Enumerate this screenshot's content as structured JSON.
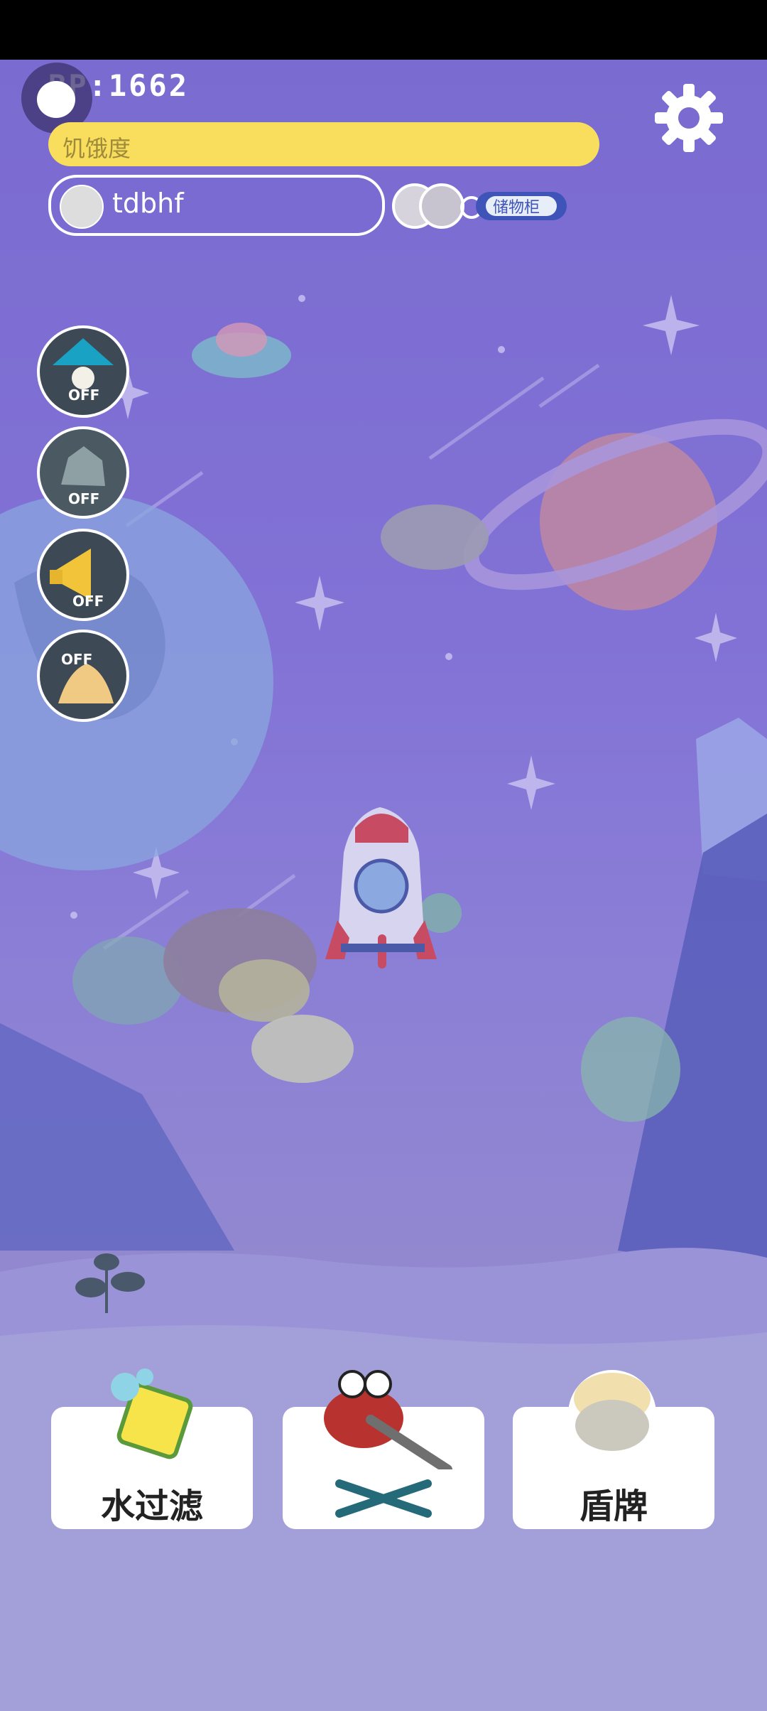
{
  "header": {
    "bp_text": "BP:1662",
    "hunger_label": "饥饿度",
    "hunger_color": "#f9dd5c"
  },
  "player": {
    "name": "tdbhf"
  },
  "locker": {
    "label": "储物柜"
  },
  "tools": [
    {
      "name": "lamp",
      "status": "OFF",
      "icon": "lamp-icon"
    },
    {
      "name": "rock",
      "status": "OFF",
      "icon": "rock-icon"
    },
    {
      "name": "megaphone",
      "status": "OFF",
      "icon": "megaphone-icon"
    },
    {
      "name": "shell",
      "status": "OFF",
      "icon": "shell-icon"
    }
  ],
  "actions": {
    "filter_label": "水过滤",
    "clean_label": "",
    "shield_label": "盾牌"
  },
  "colors": {
    "background": "#8272d6",
    "card": "#ffffff",
    "text_dark": "#222222"
  }
}
